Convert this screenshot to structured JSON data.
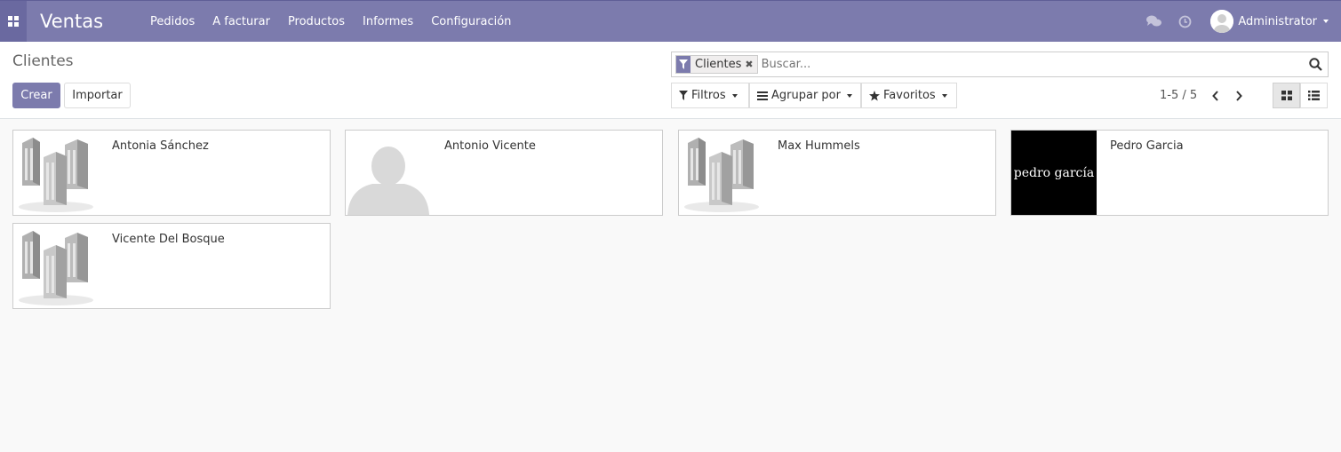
{
  "app": {
    "brand": "Ventas",
    "menu": [
      "Pedidos",
      "A facturar",
      "Productos",
      "Informes",
      "Configuración"
    ],
    "user": "Administrator"
  },
  "control": {
    "title": "Clientes",
    "create_label": "Crear",
    "import_label": "Importar",
    "search": {
      "facet": "Clientes",
      "placeholder": "Buscar..."
    },
    "filters_label": "Filtros",
    "group_label": "Agrupar por",
    "favorites_label": "Favoritos",
    "pager": "1-5 / 5"
  },
  "records": [
    {
      "name": "Antonia Sánchez",
      "image": "company"
    },
    {
      "name": "Antonio Vicente",
      "image": "person"
    },
    {
      "name": "Max Hummels",
      "image": "company"
    },
    {
      "name": "Pedro Garcia",
      "image": "logo",
      "logo_text": "pedro garcía"
    },
    {
      "name": "Vicente Del Bosque",
      "image": "company"
    }
  ],
  "colors": {
    "navbar": "#7c7bad",
    "primary": "#7c7bad"
  }
}
